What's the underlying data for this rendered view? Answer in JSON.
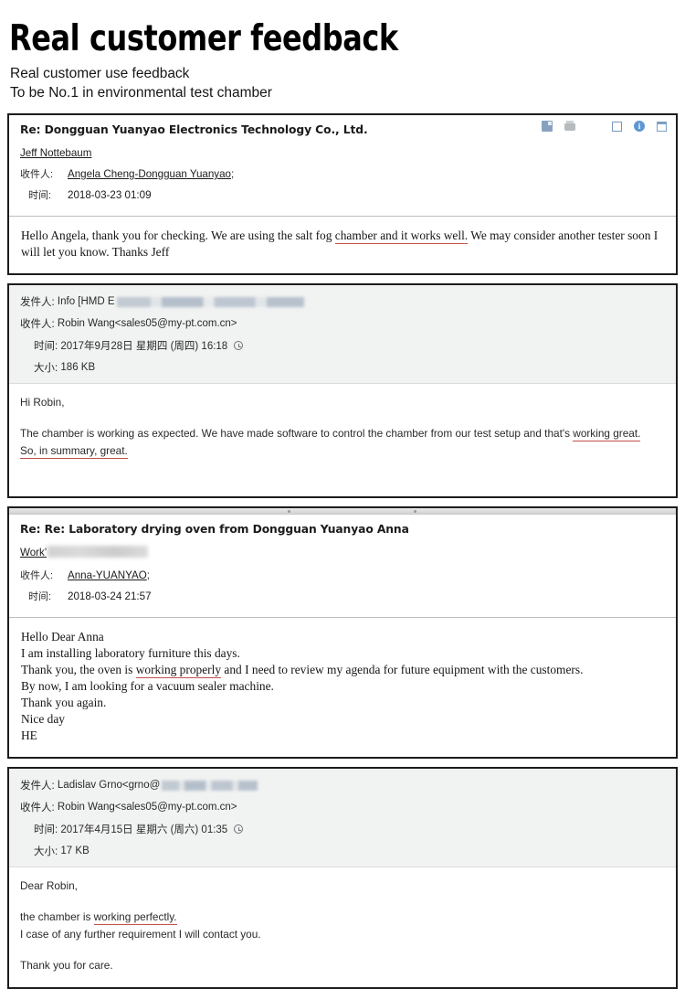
{
  "header": {
    "title": "Real customer feedback",
    "subtitle_line1": "Real customer use feedback",
    "subtitle_line2": "To be No.1 in environmental test chamber"
  },
  "labels": {
    "to": "收件人:",
    "from": "发件人:",
    "time": "时间:",
    "size": "大小:",
    "semicolon": ";"
  },
  "icons": {
    "attachment": "attachment-icon",
    "print": "print-icon",
    "flag": "flag-icon",
    "info": "info-icon",
    "window": "window-icon",
    "clock": "clock-icon",
    "info_glyph": "i"
  },
  "emails": [
    {
      "id": "email-1",
      "style": "serif",
      "subject": "Re: Dongguan Yuanyao Electronics Technology Co., Ltd.",
      "sender": "Jeff Nottebaum",
      "recipient": "Angela Cheng-Dongguan Yuanyao",
      "time": "2018-03-23 01:09",
      "body_lines": [
        {
          "segments": [
            {
              "text": "Hello Angela, thank you for checking. We are using the salt fog ",
              "underline": false
            },
            {
              "text": "chamber and it works well.",
              "underline": true
            },
            {
              "text": " We may consider another tester soon I will let you know. Thanks Jeff",
              "underline": false
            }
          ]
        }
      ]
    },
    {
      "id": "email-2",
      "style": "sans",
      "from": "Info [HMD E",
      "from_redacted": true,
      "to": "Robin Wang<sales05@my-pt.com.cn>",
      "time": "2017年9月28日 星期四 (周四) 16:18",
      "size": "186 KB",
      "body_lines": [
        {
          "segments": [
            {
              "text": "Hi Robin,",
              "underline": false
            }
          ]
        },
        {
          "blank": true
        },
        {
          "segments": [
            {
              "text": "The chamber is working as expected. We have made software to control the chamber from our test setup and that's ",
              "underline": false
            },
            {
              "text": "working great.",
              "underline": true
            }
          ]
        },
        {
          "segments": [
            {
              "text": "So, in summary, great.",
              "underline": true
            }
          ]
        }
      ]
    },
    {
      "id": "email-3",
      "style": "serif",
      "subject": "Re: Re: Laboratory drying oven from Dongguan Yuanyao Anna",
      "sender": "Work'",
      "sender_redacted": true,
      "recipient": "Anna-YUANYAO",
      "time": "2018-03-24 21:57",
      "body_lines": [
        {
          "segments": [
            {
              "text": "Hello Dear Anna",
              "underline": false
            }
          ]
        },
        {
          "segments": [
            {
              "text": "I am installing laboratory furniture this days.",
              "underline": false
            }
          ]
        },
        {
          "segments": [
            {
              "text": "Thank you, the oven is ",
              "underline": false
            },
            {
              "text": "working properly",
              "underline": true
            },
            {
              "text": " and I need to review my agenda for future equipment with the customers.",
              "underline": false
            }
          ]
        },
        {
          "segments": [
            {
              "text": "By now, I am looking  for a vacuum sealer machine.",
              "underline": false
            }
          ]
        },
        {
          "segments": [
            {
              "text": "Thank you again.",
              "underline": false
            }
          ]
        },
        {
          "segments": [
            {
              "text": "Nice day",
              "underline": false
            }
          ]
        },
        {
          "segments": [
            {
              "text": "HE",
              "underline": false
            }
          ]
        }
      ]
    },
    {
      "id": "email-4",
      "style": "sans",
      "from": "Ladislav Grno<grno@",
      "from_redacted": true,
      "to": "Robin Wang<sales05@my-pt.com.cn>",
      "time": "2017年4月15日 星期六 (周六) 01:35",
      "size": "17 KB",
      "body_lines": [
        {
          "segments": [
            {
              "text": "Dear Robin,",
              "underline": false
            }
          ]
        },
        {
          "blank": true
        },
        {
          "segments": [
            {
              "text": "the chamber is ",
              "underline": false
            },
            {
              "text": "working perfectly.",
              "underline": true
            }
          ]
        },
        {
          "segments": [
            {
              "text": "I case of any further requirement I will contact you.",
              "underline": false
            }
          ]
        },
        {
          "blank": true
        },
        {
          "segments": [
            {
              "text": "Thank you for care.",
              "underline": false
            }
          ]
        }
      ]
    }
  ],
  "colors": {
    "underline_red": "#c0504d",
    "header_bg": "#f1f2f2",
    "border": "#1c1c1c",
    "icon_blue": "#1f6fc4"
  }
}
